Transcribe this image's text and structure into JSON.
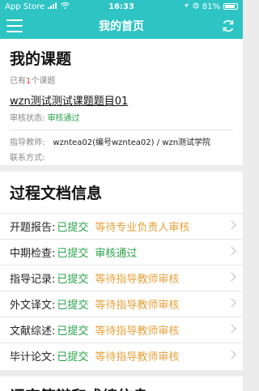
{
  "status_bar": {
    "carrier": "App Store",
    "signal": "all",
    "time": "16:33",
    "battery": "81%"
  },
  "nav": {
    "title": "我的首页",
    "menu_icon": "hamburger-menu-icon",
    "refresh_icon": "refresh-icon"
  },
  "my_topic": {
    "heading": "我的课题",
    "count_prefix": "已有",
    "count": "1",
    "count_suffix": "个课题",
    "topic_title": "wzn测试测试课题题目01",
    "review_label": "审核状态:",
    "review_status": "审核通过",
    "advisor_label": "指导教师:",
    "advisor_value": "wzntea02(编号wzntea02) / wzn测试学院",
    "contact_label": "联系方式:"
  },
  "process_docs": {
    "heading": "过程文档信息",
    "rows": [
      {
        "label": "开题报告:",
        "submitted": "已提交",
        "status": "等待专业负责人审核",
        "status_color": "#e6a23c"
      },
      {
        "label": "中期检查:",
        "submitted": "已提交",
        "status": "审核通过",
        "status_color": "#2aa34a"
      },
      {
        "label": "指导记录:",
        "submitted": "已提交",
        "status": "等待指导教师审核",
        "status_color": "#e6a23c"
      },
      {
        "label": "外文译文:",
        "submitted": "已提交",
        "status": "等待指导教师审核",
        "status_color": "#e6a23c"
      },
      {
        "label": "文献综述:",
        "submitted": "已提交",
        "status": "等待指导教师审核",
        "status_color": "#e6a23c"
      },
      {
        "label": "毕计论文:",
        "submitted": "已提交",
        "status": "等待指导教师审核",
        "status_color": "#e6a23c"
      }
    ]
  },
  "next_section": {
    "heading": "评审答辩和成绩信息"
  },
  "colors": {
    "brand": "#2ec4c4",
    "submitted_green": "#2aa34a",
    "pending_orange": "#e6a23c",
    "count_red": "#e53935"
  }
}
